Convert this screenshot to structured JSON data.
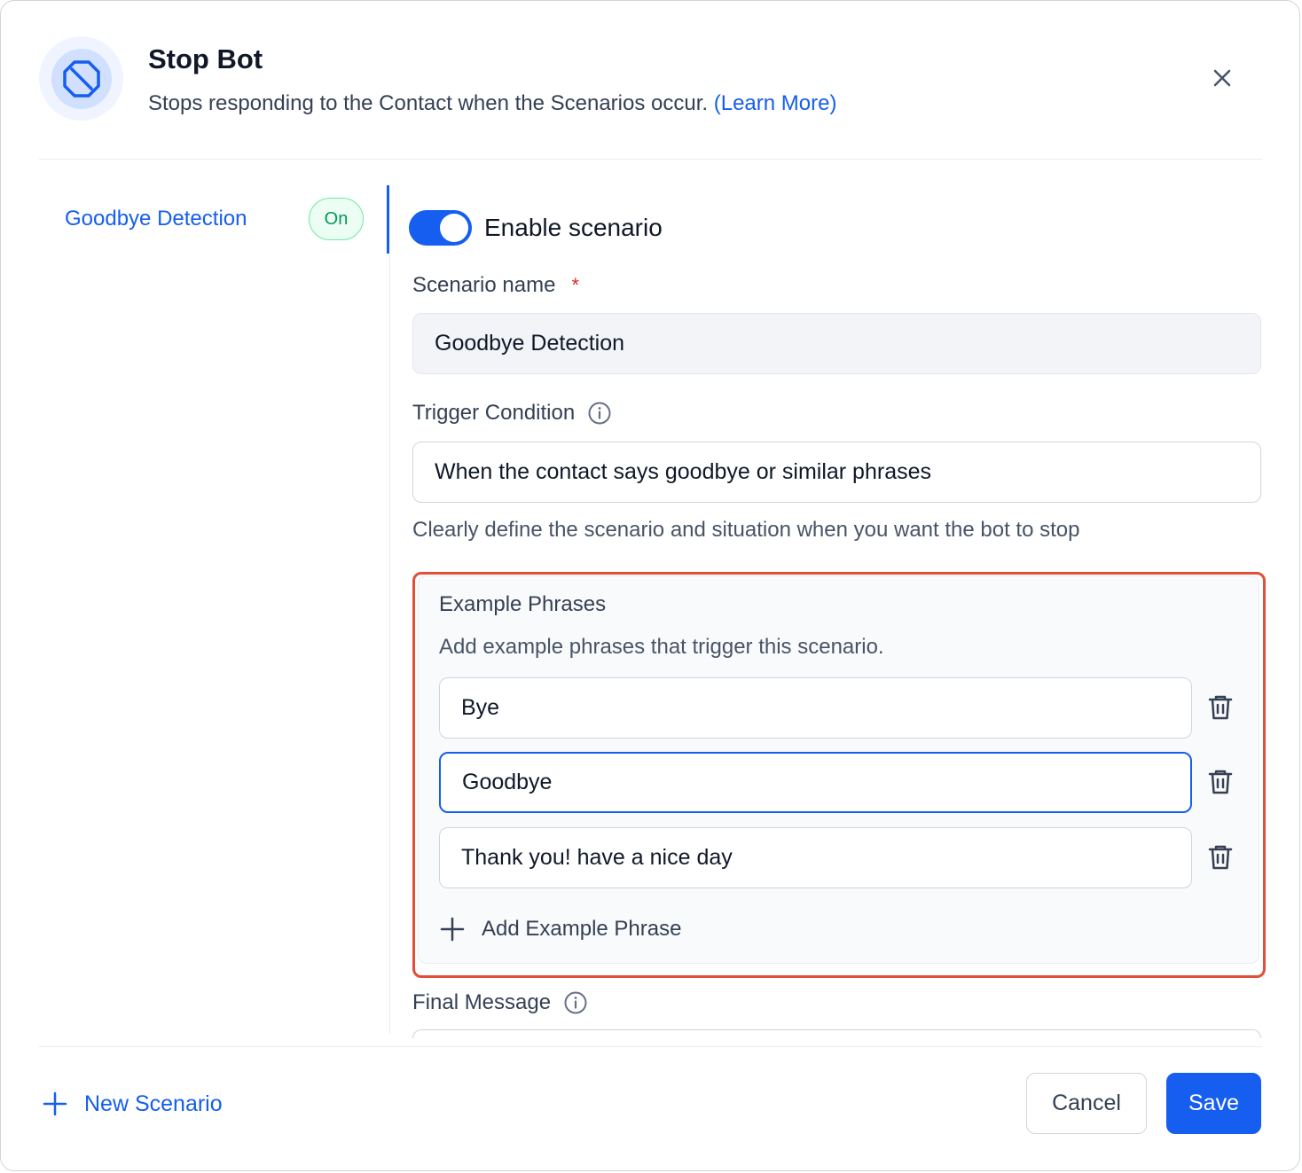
{
  "header": {
    "title": "Stop Bot",
    "subtitle": "Stops responding to the Contact when the Scenarios occur.",
    "learn_more": "(Learn More)",
    "icon": "stop-sign-icon",
    "close_icon": "close-icon"
  },
  "sidebar": {
    "items": [
      {
        "label": "Goodbye Detection",
        "status": "On"
      }
    ]
  },
  "scenario": {
    "enable_label": "Enable scenario",
    "enabled": true,
    "name_label": "Scenario name",
    "required_mark": "*",
    "name_value": "Goodbye Detection",
    "trigger_label": "Trigger Condition",
    "trigger_value": "When the contact says goodbye or similar phrases",
    "trigger_helper": "Clearly define the scenario and situation when you want the bot to stop",
    "examples": {
      "title": "Example Phrases",
      "subtitle": "Add example phrases that trigger this scenario.",
      "phrases": [
        "Bye",
        "Goodbye",
        "Thank you! have a nice day"
      ],
      "add_label": "Add Example Phrase"
    },
    "final_message_label": "Final Message"
  },
  "footer": {
    "new_scenario_label": "New Scenario",
    "cancel_label": "Cancel",
    "save_label": "Save"
  },
  "colors": {
    "accent": "#155eef",
    "success": "#039855",
    "highlight": "#e04f39"
  }
}
